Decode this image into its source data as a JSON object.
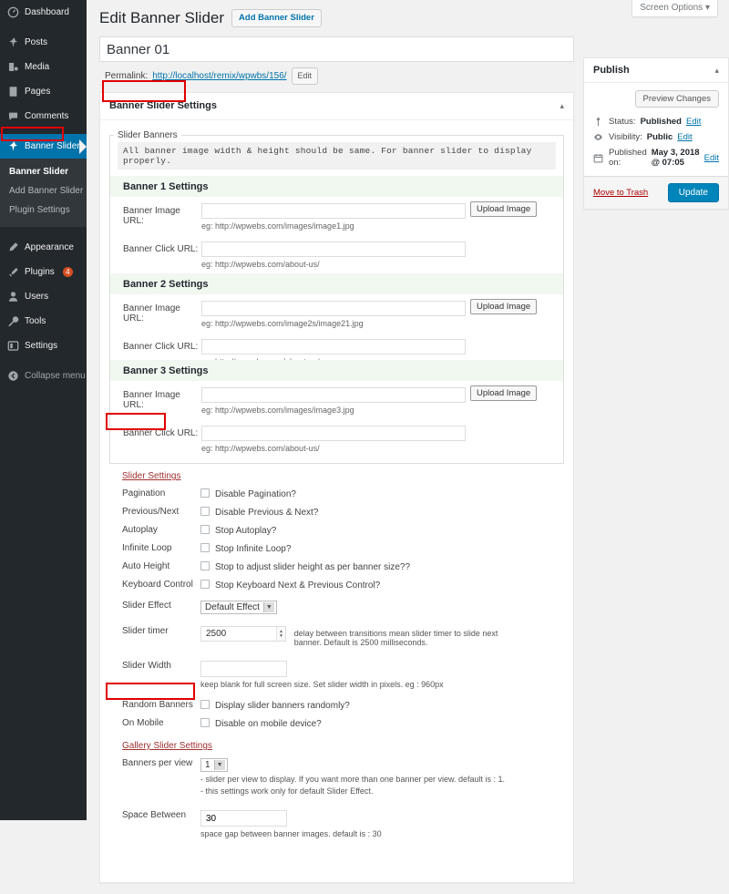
{
  "sidebar": {
    "items": [
      {
        "label": "Dashboard",
        "icon": "dashboard-icon"
      },
      {
        "label": "Posts",
        "icon": "pin-icon"
      },
      {
        "label": "Media",
        "icon": "media-icon"
      },
      {
        "label": "Pages",
        "icon": "page-icon"
      },
      {
        "label": "Comments",
        "icon": "comment-icon"
      },
      {
        "label": "Banner Slider",
        "icon": "pin-icon",
        "current": true
      }
    ],
    "submenu": [
      {
        "label": "Banner Slider",
        "current": true
      },
      {
        "label": "Add Banner Slider",
        "current": false
      },
      {
        "label": "Plugin Settings",
        "current": false
      }
    ],
    "items2": [
      {
        "label": "Appearance",
        "icon": "appearance-icon"
      },
      {
        "label": "Plugins",
        "icon": "plugin-icon",
        "badge": "4"
      },
      {
        "label": "Users",
        "icon": "users-icon"
      },
      {
        "label": "Tools",
        "icon": "tools-icon"
      },
      {
        "label": "Settings",
        "icon": "settings-icon"
      },
      {
        "label": "Collapse menu",
        "icon": "collapse-icon"
      }
    ]
  },
  "screen_meta": {
    "screen_options_label": "Screen Options"
  },
  "header": {
    "page_title": "Edit Banner Slider",
    "add_new_label": "Add Banner Slider"
  },
  "title_field": {
    "value": "Banner 01"
  },
  "permalink": {
    "label": "Permalink:",
    "url": "http://localhost/remix/wpwbs/156/",
    "edit_label": "Edit"
  },
  "metabox": {
    "title": "Banner Slider Settings",
    "toggle_icon": "chevron-up-icon",
    "fieldset_legend": "Slider Banners",
    "code_note": "All banner image width & height should be same. For banner slider to display properly.",
    "upload_label": "Upload Image",
    "image_url_label": "Banner Image URL:",
    "click_url_label": "Banner Click URL:",
    "banners": [
      {
        "heading": "Banner 1 Settings",
        "image_url_value": "",
        "image_url_hint": "eg: http://wpwebs.com/images/image1.jpg",
        "click_url_value": "",
        "click_url_hint": "eg: http://wpwebs.com/about-us/"
      },
      {
        "heading": "Banner 2 Settings",
        "image_url_value": "",
        "image_url_hint": "eg: http://wpwebs.com/image2s/image21.jpg",
        "click_url_value": "",
        "click_url_hint": "eg: http://wpwebs.com/about-us/"
      },
      {
        "heading": "Banner 3 Settings",
        "image_url_value": "",
        "image_url_hint": "eg: http://wpwebs.com/images/image3.jpg",
        "click_url_value": "",
        "click_url_hint": "eg: http://wpwebs.com/about-us/"
      }
    ]
  },
  "slider_settings": {
    "section_title": "Slider Settings",
    "rows": [
      {
        "label": "Pagination",
        "checkbox_label": "Disable Pagination?",
        "checked": false
      },
      {
        "label": "Previous/Next",
        "checkbox_label": "Disable Previous & Next?",
        "checked": false
      },
      {
        "label": "Autoplay",
        "checkbox_label": "Stop Autoplay?",
        "checked": false
      },
      {
        "label": "Infinite Loop",
        "checkbox_label": "Stop Infinite Loop?",
        "checked": false
      },
      {
        "label": "Auto Height",
        "checkbox_label": "Stop to adjust slider height as per banner size??",
        "checked": false
      },
      {
        "label": "Keyboard Control",
        "checkbox_label": "Stop Keyboard Next & Previous Control?",
        "checked": false
      }
    ],
    "slider_effect": {
      "label": "Slider Effect",
      "value": "Default Effect"
    },
    "slider_timer": {
      "label": "Slider timer",
      "value": "2500",
      "desc": "delay between transitions mean slider timer to slide next banner. Default is 2500 milliseconds."
    },
    "slider_width": {
      "label": "Slider Width",
      "value": "",
      "hint": "keep blank for full screen size. Set slider width in pixels. eg : 960px"
    },
    "rows2": [
      {
        "label": "Random Banners",
        "checkbox_label": "Display slider banners randomly?",
        "checked": false
      },
      {
        "label": "On Mobile",
        "checkbox_label": "Disable on mobile device?",
        "checked": false
      }
    ]
  },
  "gallery_settings": {
    "section_title": "Gallery Slider Settings",
    "banners_per_view": {
      "label": "Banners per view",
      "value": "1",
      "hint1": "- slider per view to display. If you want more than one banner per view. default is : 1.",
      "hint2": "- this settings work only for default Slider Effect."
    },
    "space_between": {
      "label": "Space Between",
      "value": "30",
      "hint": "space gap between banner images. default is : 30"
    }
  },
  "publish": {
    "title": "Publish",
    "toggle_icon": "chevron-up-icon",
    "preview_label": "Preview Changes",
    "status_label": "Status:",
    "status_value": "Published",
    "status_edit": "Edit",
    "visibility_label": "Visibility:",
    "visibility_value": "Public",
    "visibility_edit": "Edit",
    "published_label": "Published on:",
    "published_value": "May 3, 2018 @ 07:05",
    "published_edit": "Edit",
    "trash_label": "Move to Trash",
    "update_label": "Update"
  },
  "colors": {
    "sidebar_bg": "#23282d",
    "submenu_bg": "#32373c",
    "current_blue": "#0073aa",
    "primary_button": "#0085ba",
    "badge": "#d54e21",
    "highlight_outline": "#e00000",
    "banner_head_bg": "#f0f8f0"
  }
}
